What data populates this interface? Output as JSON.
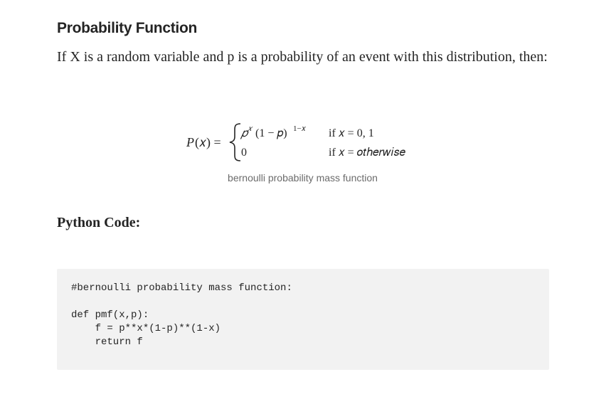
{
  "article": {
    "heading": "Probability Function",
    "paragraph": "If X is a random variable and p is a probability of an event with this distribution, then:",
    "formula": {
      "lhs_P": "P",
      "lhs_var": "(𝑥) =",
      "case1_base": "𝑝",
      "case1_exp": "𝑥",
      "case1_rest": "(1 − 𝑝)",
      "case1_exp2": "1−𝑥",
      "case1_cond": "if 𝑥 = 0, 1",
      "case2_value": "0",
      "case2_cond": "if 𝑥 = 𝑜𝑡ℎ𝑒𝑟𝑤𝑖𝑠𝑒"
    },
    "caption": "bernoulli probability mass function",
    "subheading": "Python Code:",
    "code_lines": [
      "#bernoulli probability mass function:",
      "",
      "def pmf(x,p):",
      "    f = p**x*(1-p)**(1-x)",
      "    return f"
    ]
  }
}
